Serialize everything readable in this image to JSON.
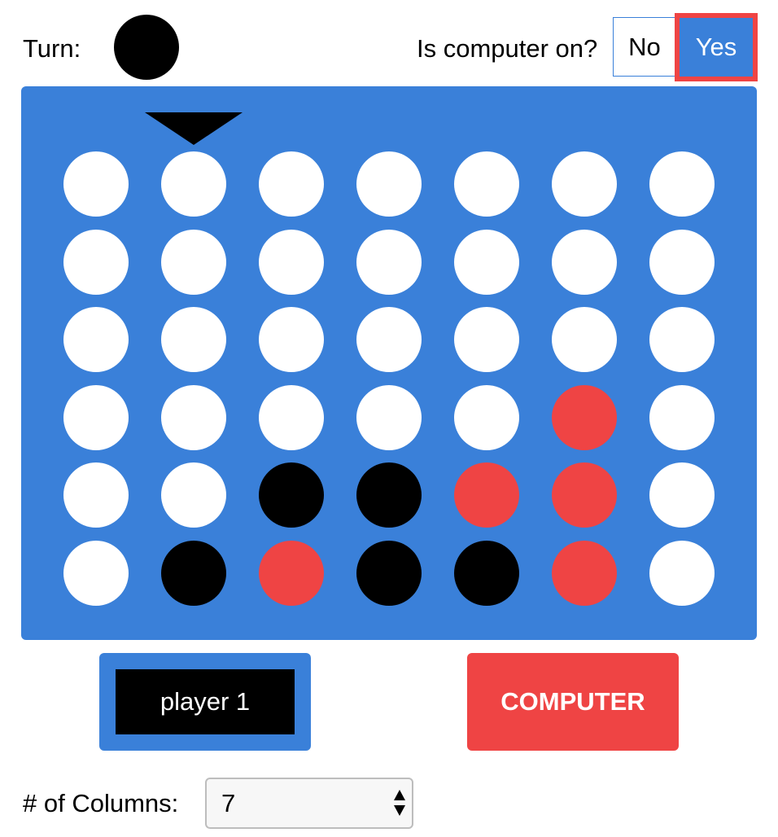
{
  "header": {
    "turn_label": "Turn:",
    "turn_color": "black",
    "computer_label": "Is computer on?",
    "no_label": "No",
    "yes_label": "Yes",
    "computer_on": true
  },
  "board": {
    "columns": 7,
    "rows": 6,
    "hover_column": 1,
    "cells": [
      [
        "empty",
        "empty",
        "empty",
        "empty",
        "empty",
        "empty",
        "empty"
      ],
      [
        "empty",
        "empty",
        "empty",
        "empty",
        "empty",
        "empty",
        "empty"
      ],
      [
        "empty",
        "empty",
        "empty",
        "empty",
        "empty",
        "empty",
        "empty"
      ],
      [
        "empty",
        "empty",
        "empty",
        "empty",
        "empty",
        "red",
        "empty"
      ],
      [
        "empty",
        "empty",
        "black",
        "black",
        "red",
        "red",
        "empty"
      ],
      [
        "empty",
        "black",
        "red",
        "black",
        "black",
        "red",
        "empty"
      ]
    ]
  },
  "players": {
    "player1_label": "player 1",
    "player2_label": "COMPUTER"
  },
  "settings": {
    "columns_label": "# of Columns:",
    "columns_value": "7"
  },
  "colors": {
    "board": "#3a80d9",
    "black": "#000000",
    "red": "#ef4444",
    "empty": "#ffffff",
    "highlight": "#ef4444"
  }
}
